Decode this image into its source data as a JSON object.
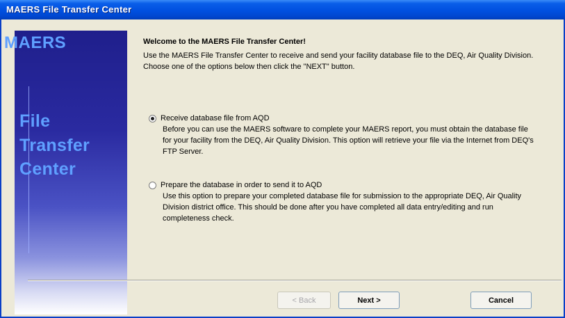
{
  "window": {
    "title": "MAERS File Transfer Center"
  },
  "side": {
    "brand": "MAERS",
    "lines": [
      "File",
      "Transfer",
      "Center"
    ]
  },
  "content": {
    "heading": "Welcome to the MAERS File Transfer Center!",
    "intro": "Use the MAERS File Transfer Center to receive and send your facility database file to the DEQ, Air Quality Division. Choose one of the options below then click the \"NEXT\" button."
  },
  "options": [
    {
      "label": "Receive database file from AQD",
      "description": "Before you can use the MAERS software to complete your MAERS report, you must obtain the database file for your facility from the DEQ, Air Quality Division. This option will retrieve your file via the Internet from DEQ's FTP Server.",
      "selected": true
    },
    {
      "label": "Prepare the database in order to send it to AQD",
      "description": "Use this option to prepare your completed database file for submission to the appropriate DEQ, Air Quality Division district office. This should be done after you have completed all data entry/editing and run completeness check.",
      "selected": false
    }
  ],
  "buttons": {
    "back": "< Back",
    "next": "Next >",
    "cancel": "Cancel"
  },
  "colors": {
    "titlebar": "#0050e0",
    "side_text": "#5fa0ff",
    "side_panel_top": "#1f1f8c"
  }
}
